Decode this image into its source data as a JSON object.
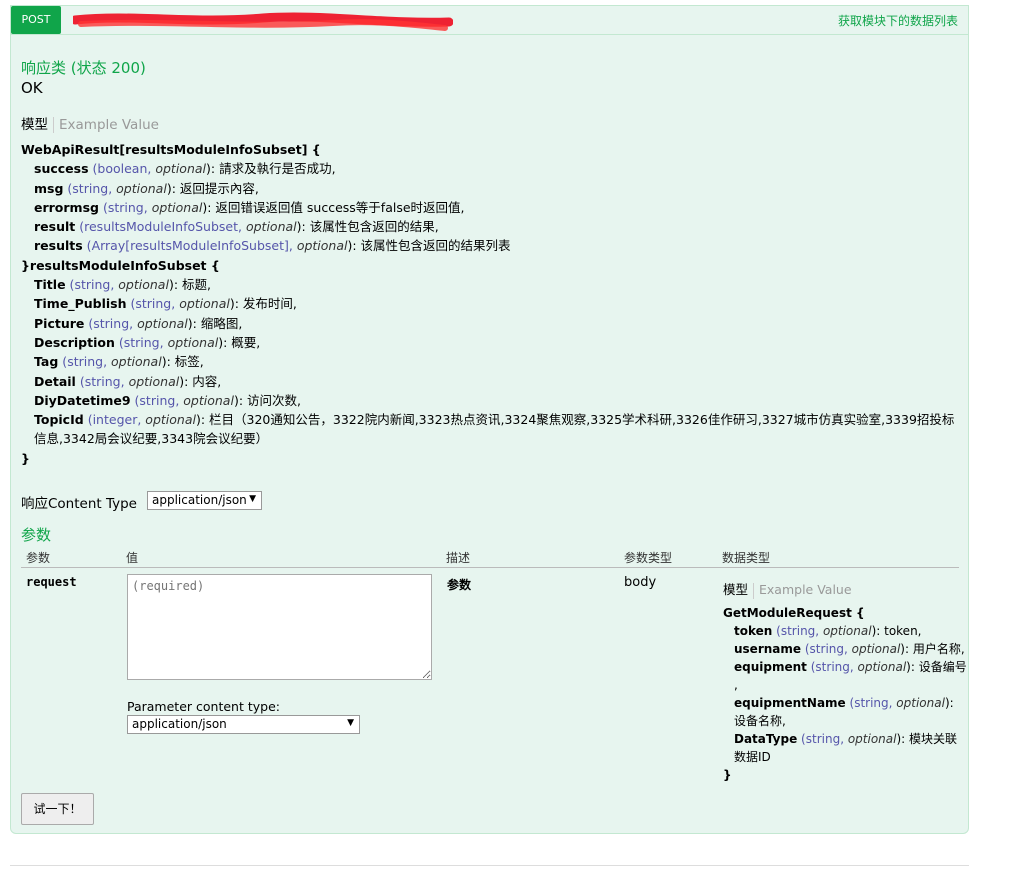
{
  "operation": {
    "method": "POST",
    "summary": "获取模块下的数据列表"
  },
  "response": {
    "heading": "响应类 (状态 200)",
    "status_text": "OK",
    "model_tab": "模型",
    "example_tab": "Example Value",
    "signature": {
      "class1": "WebApiResult[resultsModuleInfoSubset] {",
      "fields1": [
        {
          "name": "success",
          "type": "boolean",
          "opt": "optional",
          "desc": "): 請求及執行是否成功,"
        },
        {
          "name": "msg",
          "type": "string",
          "opt": "optional",
          "desc": "): 返回提示內容,"
        },
        {
          "name": "errormsg",
          "type": "string",
          "opt": "optional",
          "desc": "): 返回错误返回值 success等于false时返回值,"
        },
        {
          "name": "result",
          "type": "resultsModuleInfoSubset",
          "opt": "optional",
          "desc": "): 该属性包含返回的结果,"
        },
        {
          "name": "results",
          "type": "Array[resultsModuleInfoSubset]",
          "opt": "optional",
          "desc": "): 该属性包含返回的结果列表"
        }
      ],
      "class2": "}resultsModuleInfoSubset {",
      "fields2": [
        {
          "name": "Title",
          "type": "string",
          "opt": "optional",
          "desc": "): 标题,"
        },
        {
          "name": "Time_Publish",
          "type": "string",
          "opt": "optional",
          "desc": "): 发布时间,"
        },
        {
          "name": "Picture",
          "type": "string",
          "opt": "optional",
          "desc": "): 缩略图,"
        },
        {
          "name": "Description",
          "type": "string",
          "opt": "optional",
          "desc": "): 概要,"
        },
        {
          "name": "Tag",
          "type": "string",
          "opt": "optional",
          "desc": "): 标签,"
        },
        {
          "name": "Detail",
          "type": "string",
          "opt": "optional",
          "desc": "): 内容,"
        },
        {
          "name": "DiyDatetime9",
          "type": "string",
          "opt": "optional",
          "desc": "): 访问次数,"
        },
        {
          "name": "TopicId",
          "type": "integer",
          "opt": "optional",
          "desc": "): 栏目（320通知公告，3322院内新闻,3323热点资讯,3324聚焦观察,3325学术科研,3326佳作研习,3327城市仿真实验室,3339招投标"
        }
      ],
      "topic_cont": "信息,3342局会议纪要,3343院会议纪要）",
      "close": "}"
    },
    "content_type_label": "响应Content Type",
    "content_type_value": "application/json"
  },
  "params": {
    "heading": "参数",
    "columns": [
      "参数",
      "值",
      "描述",
      "参数类型",
      "数据类型"
    ],
    "row": {
      "name": "request",
      "placeholder": "(required)",
      "description": "参数",
      "param_type": "body",
      "model_tab": "模型",
      "example_tab": "Example Value",
      "class": "GetModuleRequest {",
      "fields": [
        {
          "name": "token",
          "type": "string",
          "opt": "optional",
          "desc": "): token,"
        },
        {
          "name": "username",
          "type": "string",
          "opt": "optional",
          "desc": "): 用户名称,"
        },
        {
          "name": "equipment",
          "type": "string",
          "opt": "optional",
          "desc": "): 设备编号"
        }
      ],
      "equipment_cont": ",",
      "field_en_name": "equipmentName",
      "field_en_type": "string",
      "field_en_opt": "optional",
      "field_en_desc": "):",
      "field_en_cont": "设备名称,",
      "field_dt_name": "DataType",
      "field_dt_type": "string",
      "field_dt_opt": "optional",
      "field_dt_desc": "): 模块关联",
      "field_dt_cont": "数据ID",
      "close": "}",
      "content_type_label": "Parameter content type:",
      "content_type_value": "application/json"
    }
  },
  "try_button": "试一下！"
}
